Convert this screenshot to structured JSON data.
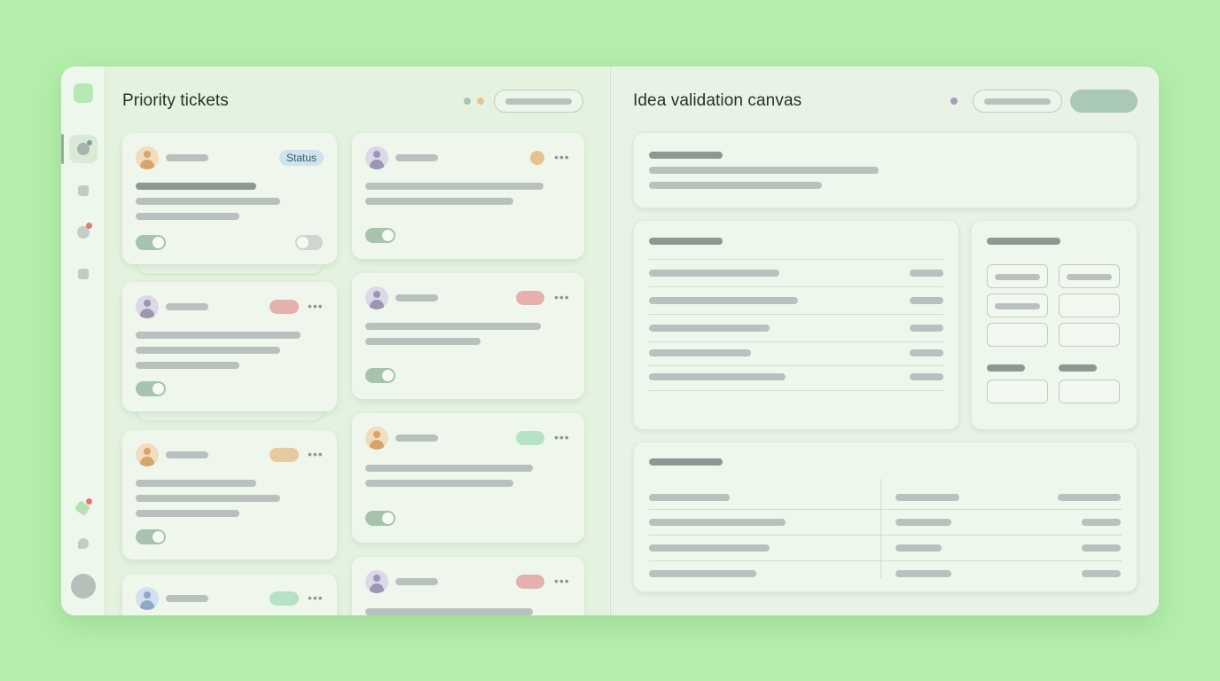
{
  "app": {
    "left_panel": {
      "title": "Priority tickets"
    },
    "right_panel": {
      "title": "Idea validation canvas"
    },
    "status_tag": "Status"
  },
  "colors": {
    "background": "#b3efaa",
    "tag_red": "#e5b1ad",
    "tag_orange": "#e9c9a0",
    "tag_green": "#b6e2c6",
    "dot_orange": "#e6c28e",
    "toggle_on": "#a7c2ad"
  },
  "icons": [
    "app-logo-icon",
    "dashboard-icon",
    "inbox-icon",
    "notifications-icon",
    "archive-icon",
    "tags-icon",
    "chat-icon",
    "user-avatar-icon",
    "more-icon"
  ],
  "tickets": {
    "col1": [
      "avatar-orange + status tag + toggle on + toggle off",
      "avatar-purple + red tag + toggle on",
      "avatar-orange + orange tag + toggle on",
      "avatar-blue + green tag"
    ],
    "col2": [
      "avatar-purple + orange dot + toggle on",
      "avatar-purple + red tag + toggle on",
      "avatar-orange + green tag + toggle on",
      "avatar-purple + red tag"
    ]
  }
}
